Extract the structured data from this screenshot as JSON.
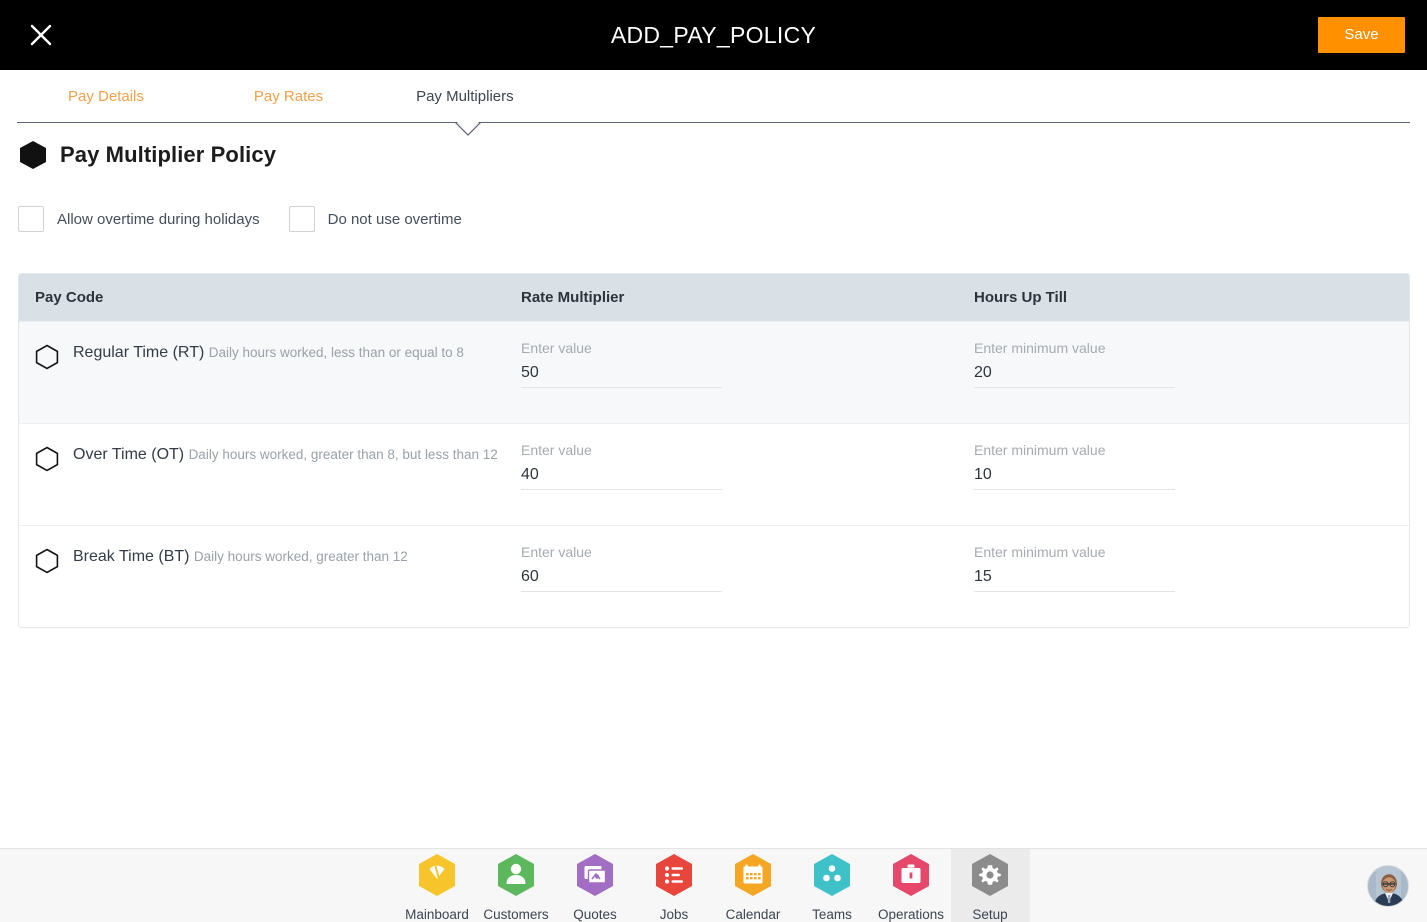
{
  "header": {
    "title": "ADD_PAY_POLICY",
    "close_icon": "close-x-icon",
    "save_label": "Save",
    "save_color": "#FF9000"
  },
  "tabs": [
    {
      "label": "Pay Details",
      "active": false
    },
    {
      "label": "Pay Rates",
      "active": false
    },
    {
      "label": "Pay Multipliers",
      "active": true
    }
  ],
  "section": {
    "icon": "hexagon-filled-icon",
    "title": "Pay Multiplier Policy"
  },
  "checkboxes": [
    {
      "label": "Allow overtime during holidays",
      "checked": false
    },
    {
      "label": "Do not use overtime",
      "checked": false
    }
  ],
  "table": {
    "columns": [
      "Pay Code",
      "Rate Multiplier",
      "Hours Up Till"
    ],
    "rows": [
      {
        "pay_code": "Regular Time (RT)",
        "description": "Daily hours worked, less than or equal to 8",
        "rate_label": "Enter value",
        "rate_value": "50",
        "hours_label": "Enter minimum value",
        "hours_value": "20"
      },
      {
        "pay_code": "Over Time (OT)",
        "description": "Daily hours worked, greater than 8, but less than 12",
        "rate_label": "Enter value",
        "rate_value": "40",
        "hours_label": "Enter minimum value",
        "hours_value": "10"
      },
      {
        "pay_code": "Break Time (BT)",
        "description": "Daily hours worked, greater than 12",
        "rate_label": "Enter value",
        "rate_value": "60",
        "hours_label": "Enter minimum value",
        "hours_value": "15"
      }
    ]
  },
  "bottom_nav": {
    "items": [
      {
        "label": "Mainboard",
        "icon": "mainboard-icon",
        "color": "#F7C52B",
        "active": false
      },
      {
        "label": "Customers",
        "icon": "person-icon",
        "color": "#5CB85C",
        "active": false
      },
      {
        "label": "Quotes",
        "icon": "quotes-icon",
        "color": "#A26EC4",
        "active": false
      },
      {
        "label": "Jobs",
        "icon": "list-icon",
        "color": "#E8453C",
        "active": false
      },
      {
        "label": "Calendar",
        "icon": "calendar-icon",
        "color": "#F5A623",
        "active": false
      },
      {
        "label": "Teams",
        "icon": "teams-icon",
        "color": "#3FC1C9",
        "active": false
      },
      {
        "label": "Operations",
        "icon": "briefcase-icon",
        "color": "#E5486B",
        "active": false
      },
      {
        "label": "Setup",
        "icon": "gear-icon",
        "color": "#8C8C8C",
        "active": true
      }
    ],
    "avatar": "user-avatar"
  }
}
